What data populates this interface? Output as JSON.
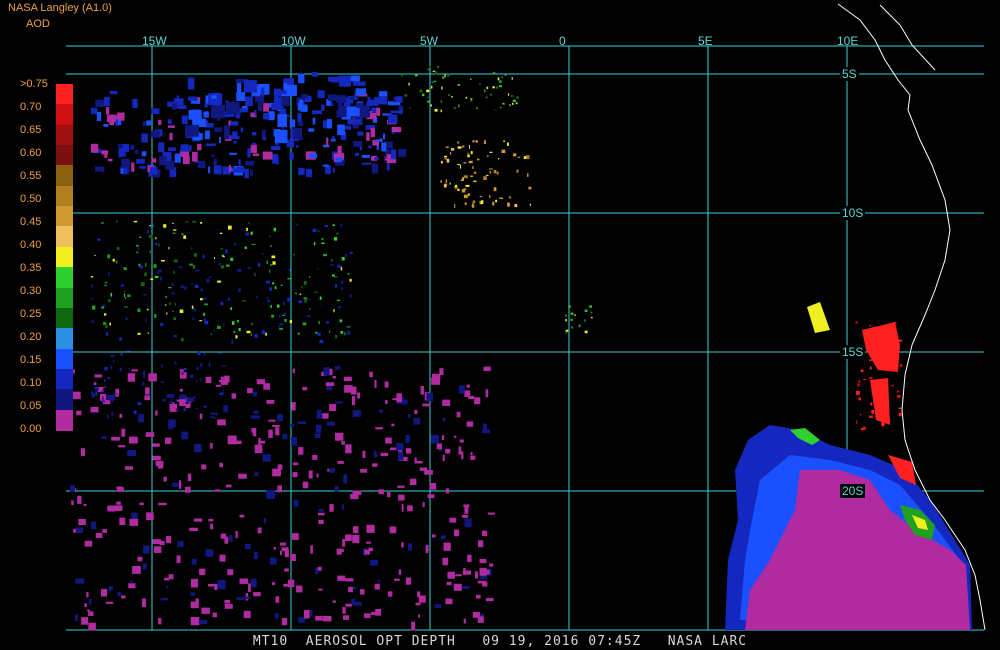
{
  "header": {
    "title": "NASA Langley (A1.0)",
    "variable": "AOD"
  },
  "footer": "MT10  AEROSOL OPT DEPTH   09 19, 2016 07:45Z   NASA LARC",
  "legend": {
    "labels": [
      ">0.75",
      "0.70",
      "0.65",
      "0.60",
      "0.55",
      "0.50",
      "0.45",
      "0.40",
      "0.35",
      "0.30",
      "0.25",
      "0.20",
      "0.15",
      "0.10",
      "0.05",
      "0.00"
    ],
    "colors": [
      "#ff2020",
      "#d01010",
      "#a01010",
      "#7a1010",
      "#8a6010",
      "#b08020",
      "#d09a30",
      "#f0c060",
      "#f0f020",
      "#30d030",
      "#20a020",
      "#106810",
      "#2a90e0",
      "#1a50ff",
      "#1428c0",
      "#101880",
      "#b02aa0"
    ]
  },
  "longitudes": [
    "15W",
    "10W",
    "5W",
    "0",
    "5E",
    "10E"
  ],
  "latitudes": [
    "5S",
    "10S",
    "15S",
    "20S"
  ],
  "colors": {
    "grid": "#3ad0d0",
    "coast": "#ffffff",
    "label": "#f0a040"
  }
}
